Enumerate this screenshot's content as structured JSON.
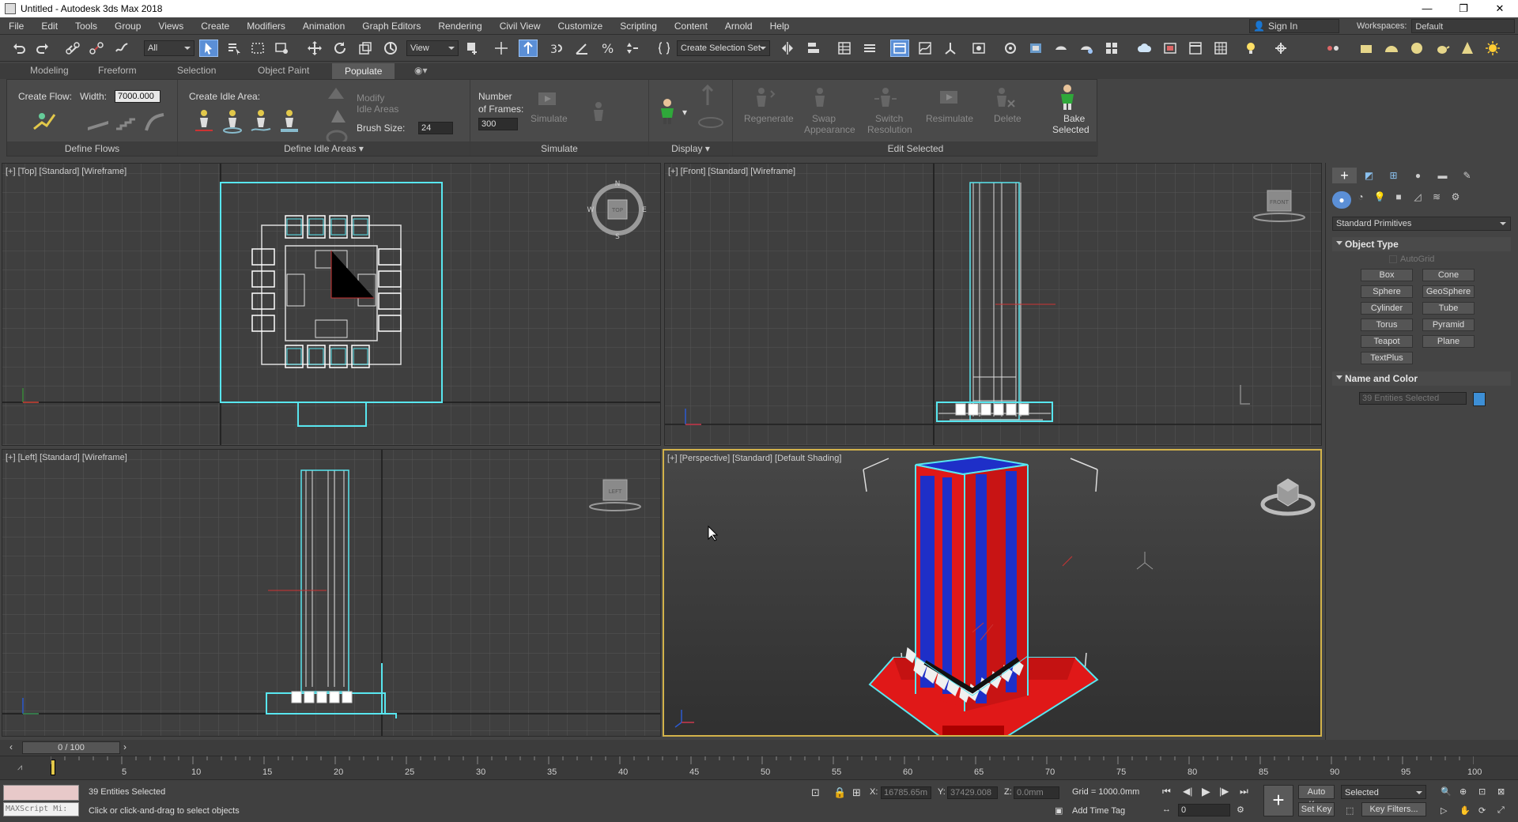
{
  "window": {
    "title": "Untitled - Autodesk 3ds Max 2018",
    "min": "—",
    "restore": "❐",
    "close": "✕"
  },
  "menu": [
    "File",
    "Edit",
    "Tools",
    "Group",
    "Views",
    "Create",
    "Modifiers",
    "Animation",
    "Graph Editors",
    "Rendering",
    "Civil View",
    "Customize",
    "Scripting",
    "Content",
    "Arnold",
    "Help"
  ],
  "signin": "Sign In",
  "workspaces": {
    "label": "Workspaces:",
    "value": "Default"
  },
  "toolbar": {
    "filter": "All",
    "refcoord": "View",
    "selset": "Create Selection Set"
  },
  "ribbon_tabs": [
    "Modeling",
    "Freeform",
    "Selection",
    "Object Paint",
    "Populate"
  ],
  "ribbon": {
    "create_flow": "Create Flow:",
    "width_label": "Width:",
    "width_value": "7000.000",
    "define_flows": "Define Flows",
    "create_idle": "Create Idle Area:",
    "modify_idle": "Modify",
    "modify_idle2": "Idle Areas",
    "brush_label": "Brush Size:",
    "brush_value": "24",
    "define_idle": "Define Idle Areas",
    "frames_label": "Number",
    "frames_label2": "of Frames:",
    "frames_value": "300",
    "simulate_btn": "Simulate",
    "simulate_group": "Simulate",
    "display_group": "Display",
    "regenerate": "Regenerate",
    "swap": "Swap",
    "swap2": "Appearance",
    "switch": "Switch",
    "switch2": "Resolution",
    "resimulate": "Resimulate",
    "delete": "Delete",
    "bake": "Bake",
    "bake2": "Selected",
    "edit_selected": "Edit Selected"
  },
  "viewports": {
    "top": "[+] [Top] [Standard] [Wireframe]",
    "front": "[+] [Front] [Standard] [Wireframe]",
    "left": "[+] [Left] [Standard] [Wireframe]",
    "persp": "[+] [Perspective] [Standard] [Default Shading]",
    "compass": {
      "n": "N",
      "s": "S",
      "e": "E",
      "w": "W",
      "cube": "TOP"
    },
    "front_cube": "FRONT",
    "left_cube": "LEFT"
  },
  "command_panel": {
    "category": "Standard Primitives",
    "object_type": "Object Type",
    "autogrid": "AutoGrid",
    "buttons": [
      "Box",
      "Cone",
      "Sphere",
      "GeoSphere",
      "Cylinder",
      "Tube",
      "Torus",
      "Pyramid",
      "Teapot",
      "Plane",
      "TextPlus"
    ],
    "name_color": "Name and Color",
    "name_value": "39 Entities Selected",
    "color": "#3d8fd6"
  },
  "timeline": {
    "slider": "0 / 100",
    "ticks": [
      "5",
      "10",
      "15",
      "20",
      "25",
      "30",
      "35",
      "40",
      "45",
      "50",
      "55",
      "60",
      "65",
      "70",
      "75",
      "80",
      "85",
      "90",
      "95",
      "100"
    ]
  },
  "status": {
    "maxscript": "MAXScript Mi:",
    "selected": "39 Entities Selected",
    "hint": "Click or click-and-drag to select objects",
    "x_label": "X:",
    "x": "16785.65m",
    "y_label": "Y:",
    "y": "37429.008",
    "z_label": "Z:",
    "z": "0.0mm",
    "grid": "Grid = 1000.0mm",
    "add_time_tag": "Add Time Tag",
    "frame": "0",
    "auto_key": "Auto Key",
    "set_key": "Set Key",
    "selected_dd": "Selected",
    "key_filters": "Key Filters..."
  },
  "colors": {
    "cyan": "#58e6ef",
    "red": "#e01818",
    "blue": "#1e2fc8",
    "accent": "#5b8fd6"
  }
}
